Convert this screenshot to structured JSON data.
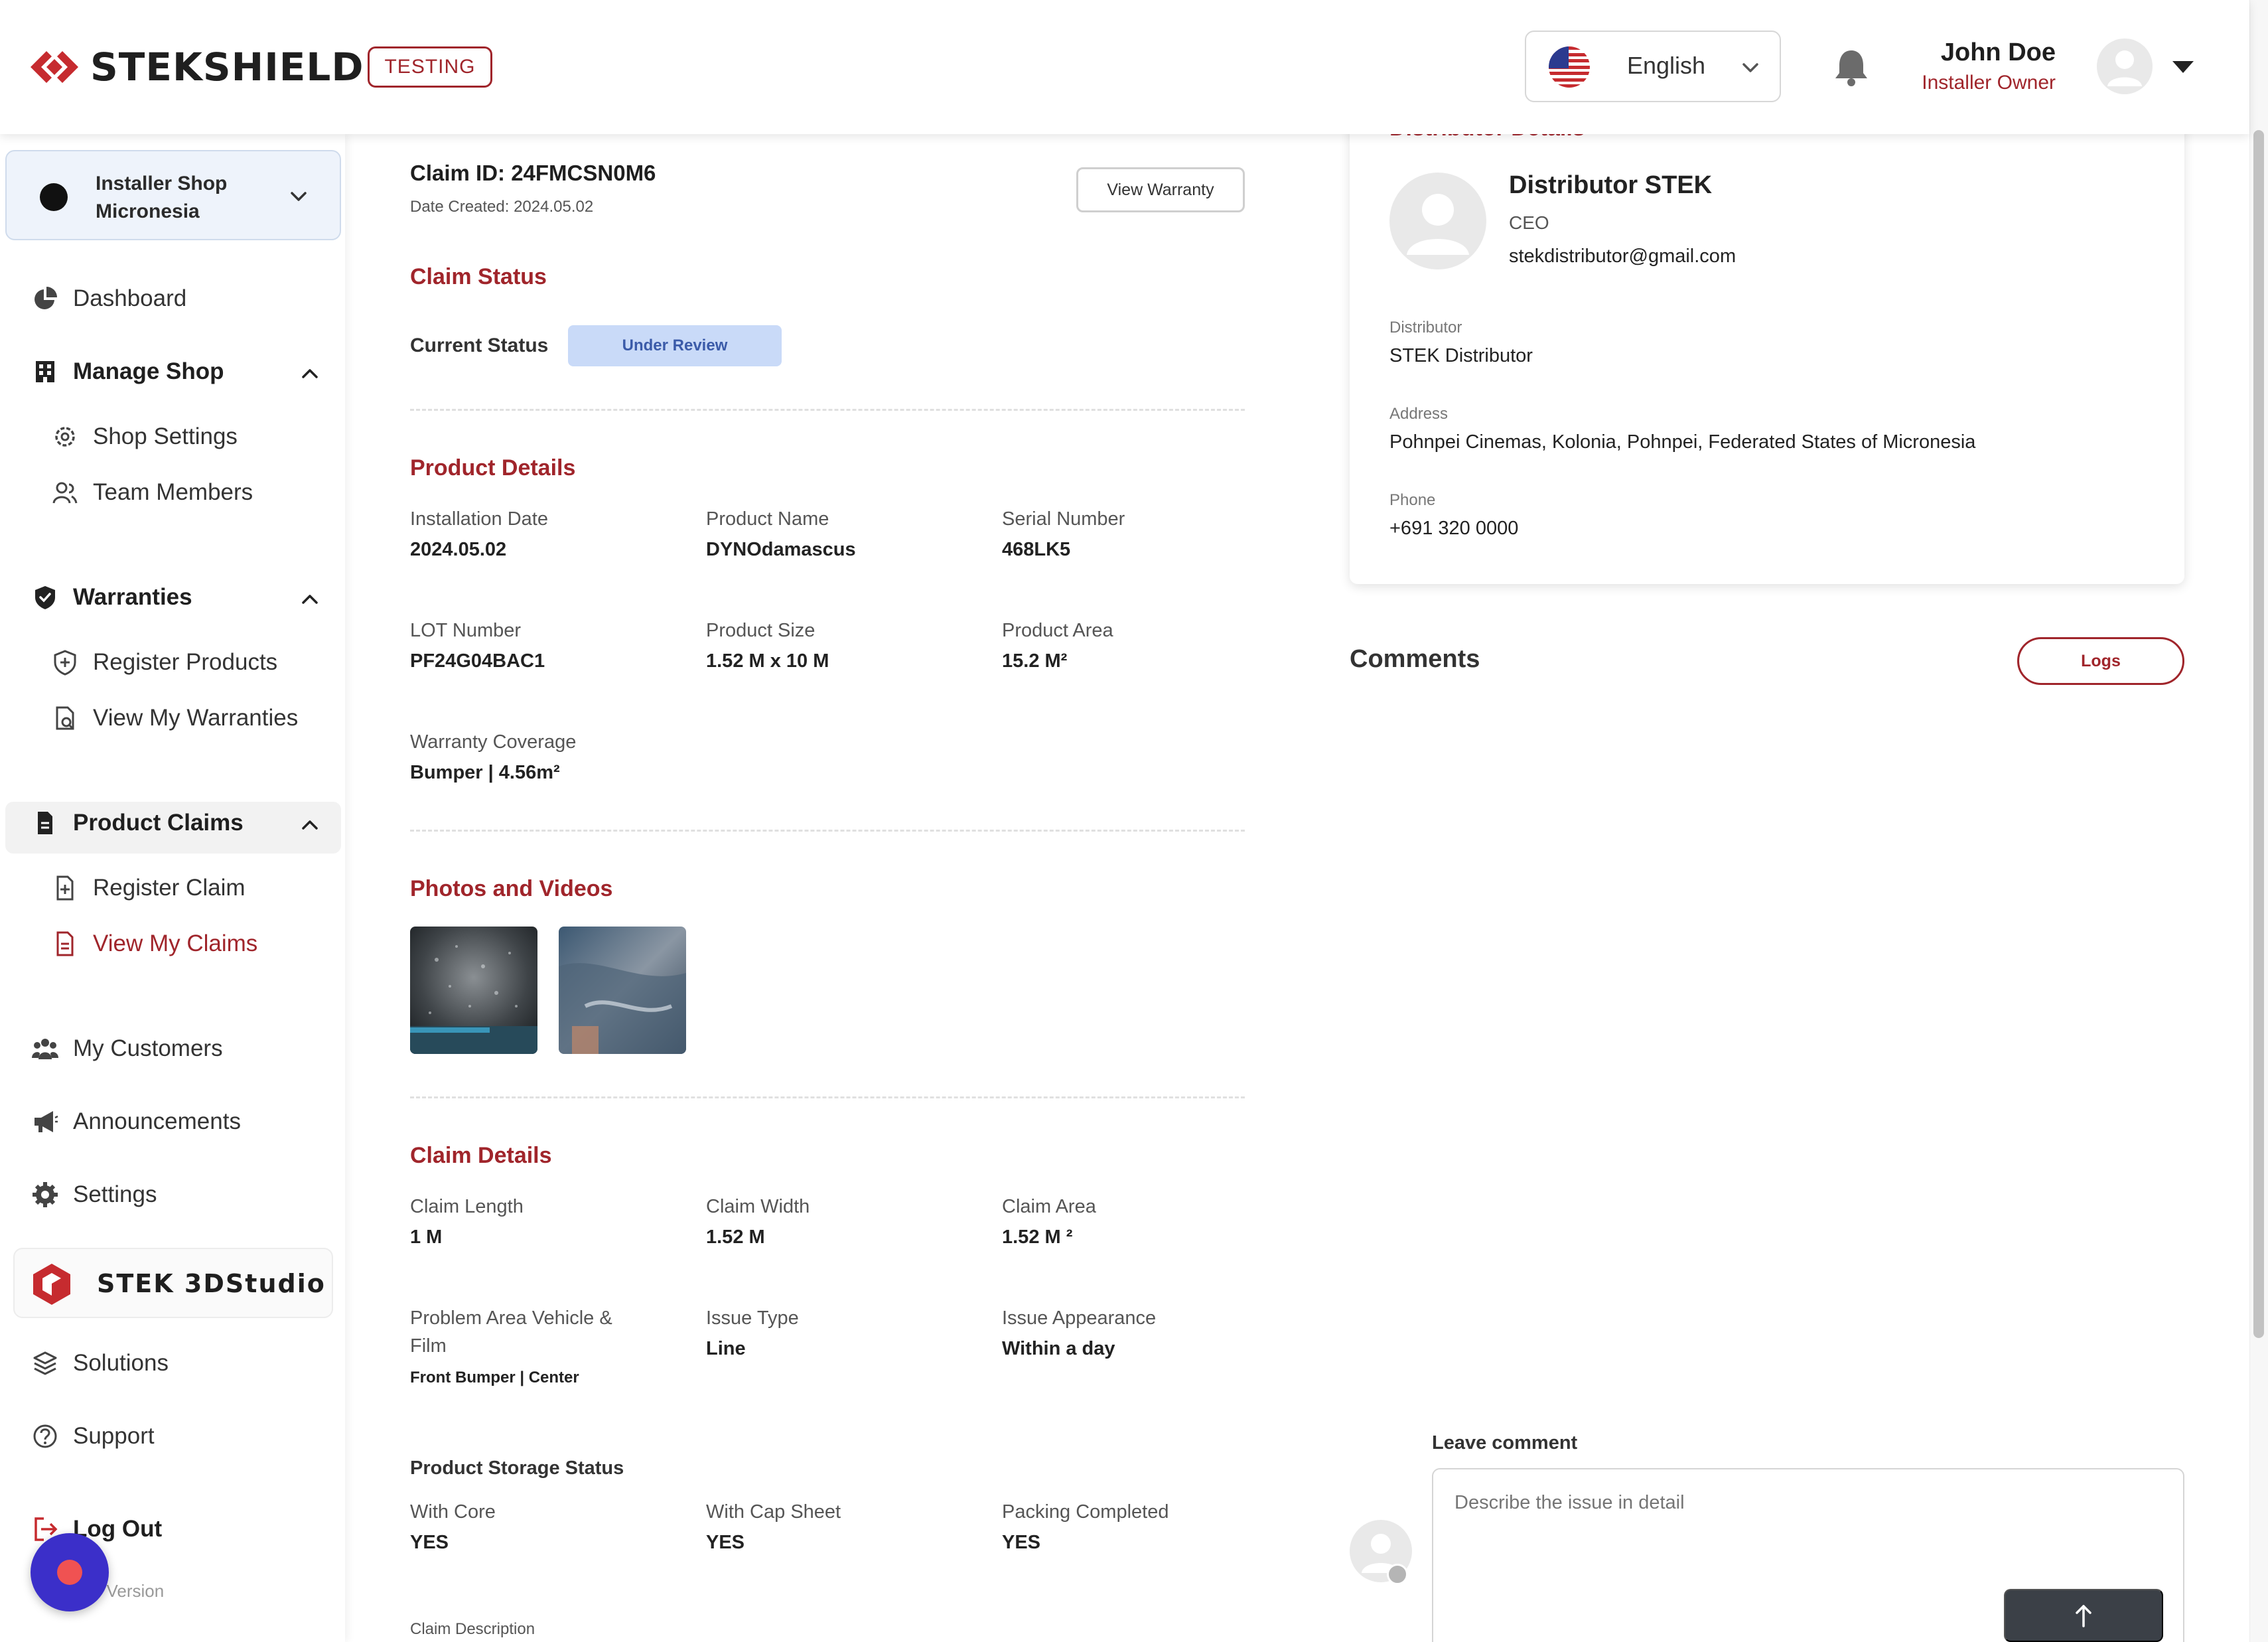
{
  "header": {
    "logo_text": "STEKSHIELD",
    "env_badge": "TESTING",
    "language": "English",
    "user_name": "John Doe",
    "user_role": "Installer Owner"
  },
  "sidebar": {
    "shop_name_line1": "Installer Shop",
    "shop_name_line2": "Micronesia",
    "items": {
      "dashboard": "Dashboard",
      "manage_shop": "Manage Shop",
      "shop_settings": "Shop Settings",
      "team_members": "Team Members",
      "warranties": "Warranties",
      "register_products": "Register Products",
      "view_my_warranties": "View My Warranties",
      "product_claims": "Product Claims",
      "register_claim": "Register Claim",
      "view_my_claims": "View My Claims",
      "my_customers": "My Customers",
      "announcements": "Announcements",
      "settings": "Settings",
      "studio": "STEK 3DStudio",
      "solutions": "Solutions",
      "support": "Support",
      "log_out": "Log Out"
    },
    "version_text": "LD Version"
  },
  "claim": {
    "id_text": "Claim ID: 24FMCSN0M6",
    "date_created": "Date Created: 2024.05.02",
    "view_warranty_label": "View Warranty",
    "status_section": "Claim Status",
    "current_status_label": "Current Status",
    "current_status_value": "Under Review",
    "product_section": "Product Details",
    "product_fields": {
      "installation_date_label": "Installation Date",
      "installation_date_value": "2024.05.02",
      "product_name_label": "Product Name",
      "product_name_value": "DYNOdamascus",
      "serial_number_label": "Serial Number",
      "serial_number_value": "468LK5",
      "lot_number_label": "LOT Number",
      "lot_number_value": "PF24G04BAC1",
      "product_size_label": "Product Size",
      "product_size_value": "1.52 M x 10 M",
      "product_area_label": "Product Area",
      "product_area_value": "15.2 M²",
      "warranty_coverage_label": "Warranty Coverage",
      "warranty_coverage_value": "Bumper | 4.56m²"
    },
    "photos_section": "Photos and Videos",
    "details_section": "Claim Details",
    "detail_fields": {
      "claim_length_label": "Claim Length",
      "claim_length_value": "1 M",
      "claim_width_label": "Claim Width",
      "claim_width_value": "1.52 M",
      "claim_area_label": "Claim Area",
      "claim_area_value": "1.52 M ²",
      "problem_area_label_line1": "Problem Area Vehicle &",
      "problem_area_label_line2": "Film",
      "problem_area_value": "Front Bumper | Center",
      "issue_type_label": "Issue Type",
      "issue_type_value": "Line",
      "issue_appearance_label": "Issue Appearance",
      "issue_appearance_value": "Within a day"
    },
    "storage_section": "Product Storage Status",
    "storage_fields": {
      "with_core_label": "With Core",
      "with_core_value": "YES",
      "cap_sheet_label": "With Cap Sheet",
      "cap_sheet_value": "YES",
      "packing_label": "Packing Completed",
      "packing_value": "YES"
    },
    "description_label": "Claim Description"
  },
  "distributor": {
    "section_title": "Distributor Details",
    "name": "Distributor STEK",
    "role": "CEO",
    "email": "stekdistributor@gmail.com",
    "distributor_label": "Distributor",
    "distributor_value": "STEK Distributor",
    "address_label": "Address",
    "address_value": "Pohnpei Cinemas, Kolonia, Pohnpei, Federated States of Micronesia",
    "phone_label": "Phone",
    "phone_value": "+691 320 0000"
  },
  "comments": {
    "title": "Comments",
    "logs_label": "Logs",
    "leave_comment_label": "Leave comment",
    "placeholder": "Describe the issue in detail"
  },
  "colors": {
    "brand_red": "#a0252b",
    "status_pill_bg": "#c9daf8",
    "status_pill_text": "#3b5ba9",
    "record_button": "#3b2fc9"
  },
  "icons": [
    "stekshield-logo",
    "us-flag-icon",
    "chevron-down-icon",
    "bell-icon",
    "user-avatar-icon",
    "caret-down-icon",
    "dashboard-pie-icon",
    "building-icon",
    "gear-icon",
    "team-icon",
    "shield-check-icon",
    "shield-plus-icon",
    "document-search-icon",
    "document-icon",
    "document-plus-icon",
    "customers-icon",
    "megaphone-icon",
    "layers-icon",
    "help-circle-icon",
    "logout-icon",
    "arrow-up-icon"
  ]
}
